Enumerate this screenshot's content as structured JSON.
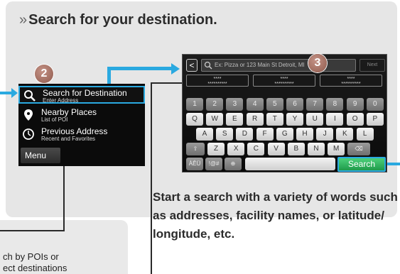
{
  "headline": {
    "marker": "»",
    "text": "Search for your destination."
  },
  "steps": {
    "step2": "2",
    "step3": "3"
  },
  "nav_menu": {
    "items": [
      {
        "title": "Search for Destination",
        "subtitle": "Enter Address",
        "icon": "search-icon",
        "selected": true
      },
      {
        "title": "Nearby Places",
        "subtitle": "List of POI",
        "icon": "pin-icon",
        "selected": false
      },
      {
        "title": "Previous Address",
        "subtitle": "Recent and Favorites",
        "icon": "clock-icon",
        "selected": false
      }
    ],
    "menu_button": "Menu"
  },
  "keyboard_screen": {
    "back": "<",
    "placeholder": "Ex: Pizza or 123 Main St Detroit, MI",
    "next_label": "Next",
    "suggestions": [
      {
        "line1": "****",
        "line2": "**********"
      },
      {
        "line1": "****",
        "line2": "**********"
      },
      {
        "line1": "****",
        "line2": "**********"
      }
    ],
    "number_row": [
      "1",
      "2",
      "3",
      "4",
      "5",
      "6",
      "7",
      "8",
      "9",
      "0"
    ],
    "row1": [
      "Q",
      "W",
      "E",
      "R",
      "T",
      "Y",
      "U",
      "I",
      "O",
      "P"
    ],
    "row2": [
      "A",
      "S",
      "D",
      "F",
      "G",
      "H",
      "J",
      "K",
      "L"
    ],
    "row3": [
      "Z",
      "X",
      "C",
      "V",
      "B",
      "N",
      "M"
    ],
    "shift": "⇧",
    "backspace": "⌫",
    "lang_key": "ÀÊÜ",
    "symbol_key": "!@#",
    "globe": "⊕",
    "search_key": "Search"
  },
  "caption": "Start a search with a variety of words such as addresses, facility names, or latitude/ longitude, etc.",
  "bottom_note": {
    "line1": "ch by POIs or",
    "line2": "ect destinations"
  },
  "colors": {
    "accent_blue": "#2aa9e0",
    "search_green": "#2fb35a",
    "badge": "#a36b5c"
  }
}
